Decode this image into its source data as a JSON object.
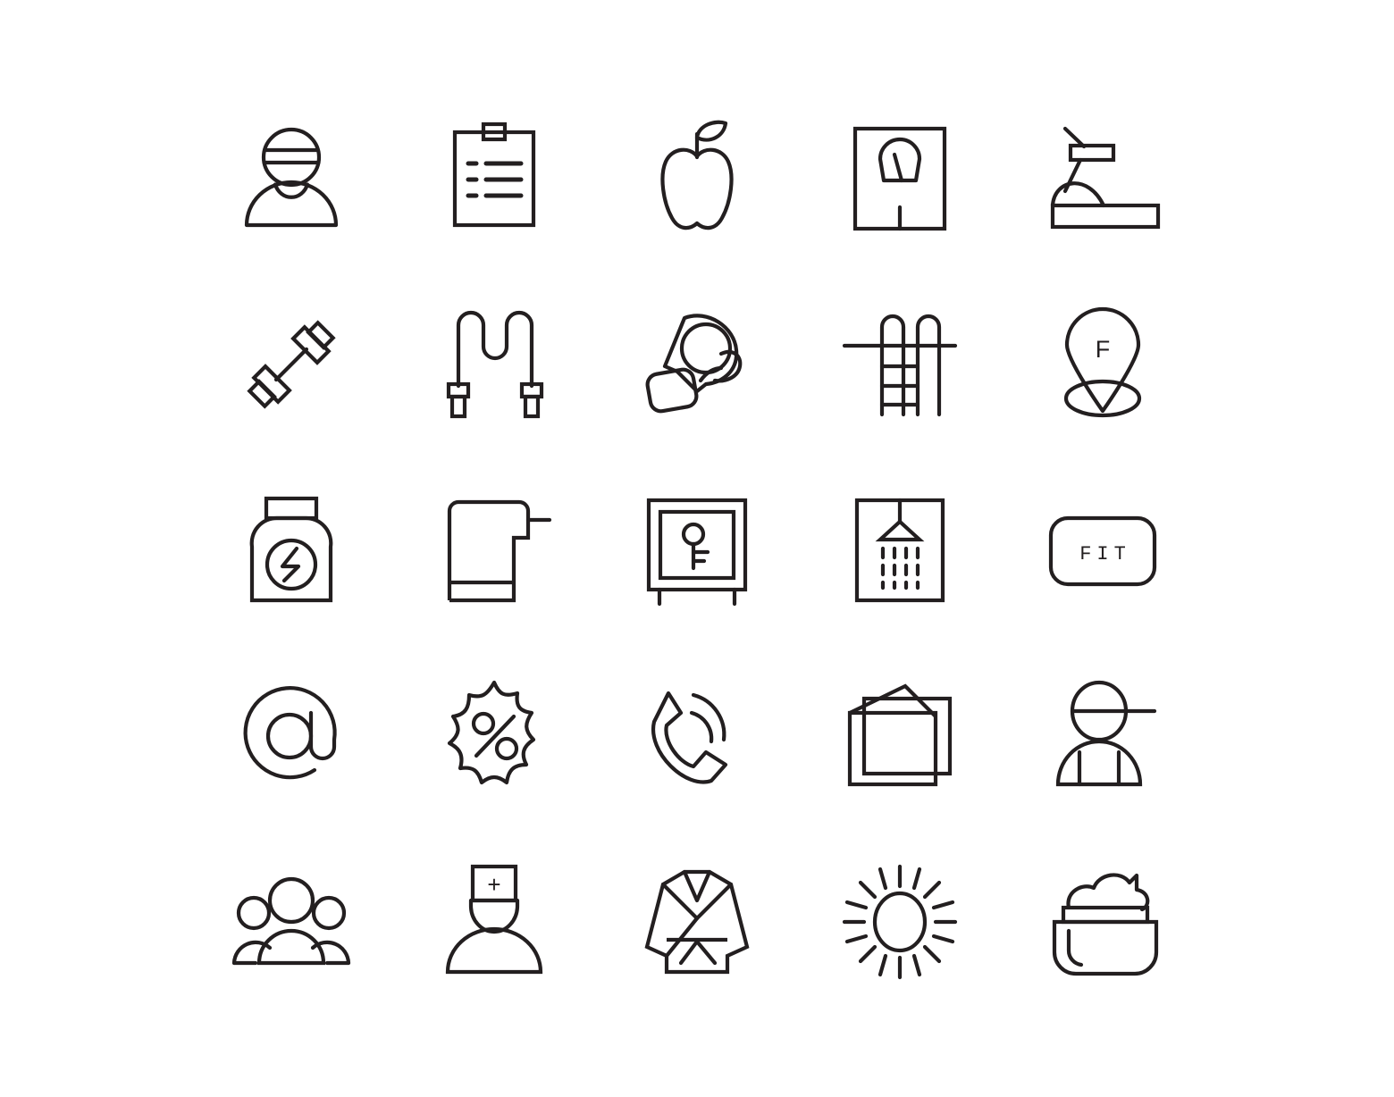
{
  "sheet": {
    "title": "Fitness & Gym Line Icon Set",
    "background_color": "#ffffff",
    "stroke_color": "#231f20",
    "stroke_width": 4.2,
    "columns": 5,
    "rows": 5,
    "icon_count": 25,
    "style": "outline / line-art monochrome"
  },
  "icons": [
    {
      "id": 1,
      "name": "trainer-icon",
      "label": "Personal Trainer",
      "row": 1,
      "col": 1
    },
    {
      "id": 2,
      "name": "clipboard-icon",
      "label": "Workout Plan Clipboard",
      "row": 1,
      "col": 2
    },
    {
      "id": 3,
      "name": "apple-icon",
      "label": "Apple / Nutrition",
      "row": 1,
      "col": 3
    },
    {
      "id": 4,
      "name": "weight-scale-icon",
      "label": "Weight Scale",
      "row": 1,
      "col": 4
    },
    {
      "id": 5,
      "name": "treadmill-icon",
      "label": "Treadmill",
      "row": 1,
      "col": 5
    },
    {
      "id": 6,
      "name": "dumbbell-icon",
      "label": "Dumbbell",
      "row": 2,
      "col": 1
    },
    {
      "id": 7,
      "name": "jump-rope-icon",
      "label": "Jump Rope",
      "row": 2,
      "col": 2
    },
    {
      "id": 8,
      "name": "boxing-glove-icon",
      "label": "Boxing Glove",
      "row": 2,
      "col": 3
    },
    {
      "id": 9,
      "name": "pool-ladder-icon",
      "label": "Swimming Pool Ladder",
      "row": 2,
      "col": 4
    },
    {
      "id": 10,
      "name": "location-pin-f-icon",
      "label": "Gym Location Pin",
      "row": 2,
      "col": 5,
      "text": "F"
    },
    {
      "id": 11,
      "name": "supplement-jar-icon",
      "label": "Supplement Jar",
      "row": 3,
      "col": 1
    },
    {
      "id": 12,
      "name": "towel-icon",
      "label": "Towel on Rack",
      "row": 3,
      "col": 2
    },
    {
      "id": 13,
      "name": "locker-safe-icon",
      "label": "Locker / Safe",
      "row": 3,
      "col": 3
    },
    {
      "id": 14,
      "name": "shower-icon",
      "label": "Shower",
      "row": 3,
      "col": 4
    },
    {
      "id": 15,
      "name": "fit-badge-icon",
      "label": "FIT Badge",
      "row": 3,
      "col": 5,
      "text": "FIT"
    },
    {
      "id": 16,
      "name": "at-sign-icon",
      "label": "Email / At Sign",
      "row": 4,
      "col": 1
    },
    {
      "id": 17,
      "name": "discount-percent-icon",
      "label": "Discount Percent",
      "row": 4,
      "col": 2
    },
    {
      "id": 18,
      "name": "ringing-phone-icon",
      "label": "Ringing Phone",
      "row": 4,
      "col": 3
    },
    {
      "id": 19,
      "name": "wallet-cards-icon",
      "label": "Wallet / Membership Cards",
      "row": 4,
      "col": 4
    },
    {
      "id": 20,
      "name": "member-person-icon",
      "label": "Gym Member",
      "row": 4,
      "col": 5
    },
    {
      "id": 21,
      "name": "group-people-icon",
      "label": "Group Class",
      "row": 5,
      "col": 1
    },
    {
      "id": 22,
      "name": "medic-person-icon",
      "label": "Medic / Nurse",
      "row": 5,
      "col": 2,
      "text": "+"
    },
    {
      "id": 23,
      "name": "karate-gi-icon",
      "label": "Karate Gi / Martial Arts",
      "row": 5,
      "col": 3
    },
    {
      "id": 24,
      "name": "sun-icon",
      "label": "Sun / Solarium",
      "row": 5,
      "col": 4
    },
    {
      "id": 25,
      "name": "cream-jar-icon",
      "label": "Cream Jar / Spa",
      "row": 5,
      "col": 5
    }
  ]
}
